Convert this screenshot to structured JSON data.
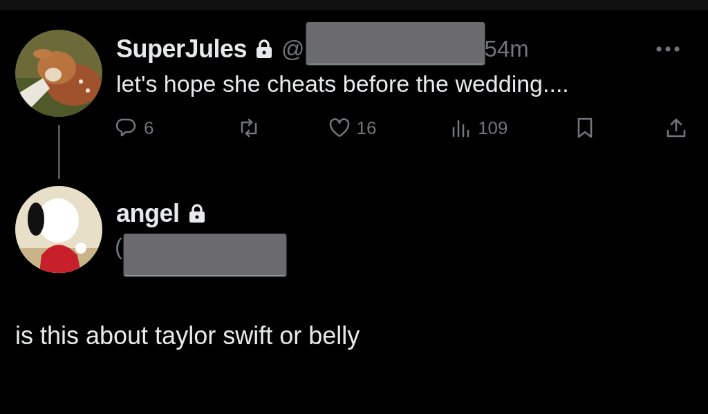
{
  "tweet": {
    "name": "SuperJules",
    "protected": true,
    "handle_prefix": "@",
    "time": "54m",
    "text": "let's hope she cheats before the wedding....",
    "actions": [
      {
        "kind": "reply",
        "count": "6"
      },
      {
        "kind": "repost"
      },
      {
        "kind": "like",
        "count": "16"
      },
      {
        "kind": "views",
        "count": "109"
      },
      {
        "kind": "bookmark"
      },
      {
        "kind": "share"
      }
    ]
  },
  "reply": {
    "name": "angel",
    "protected": true,
    "handle_prefix": "(",
    "text": "is this about taylor swift or belly"
  }
}
